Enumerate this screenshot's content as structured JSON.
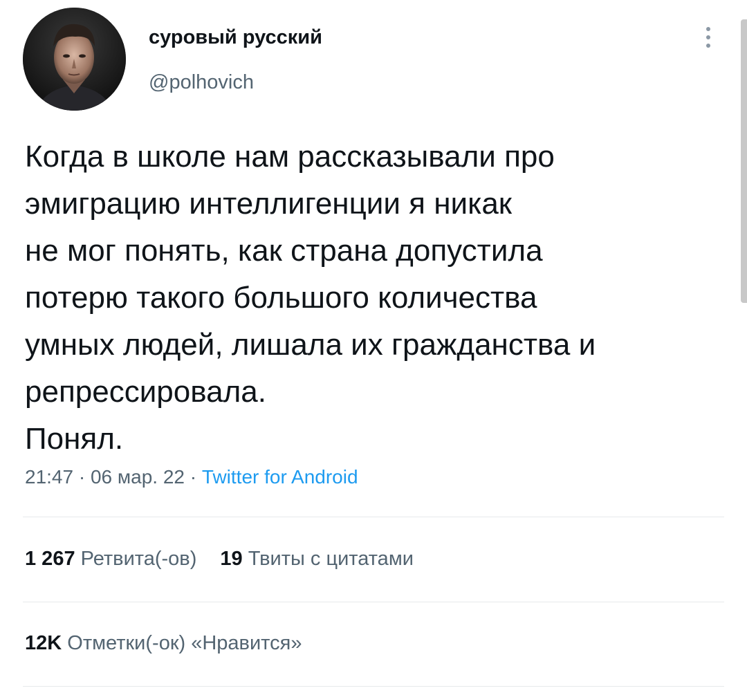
{
  "author": {
    "display_name": "суровый русский",
    "handle": "@polhovich",
    "avatar_icon": "user-photo-avatar"
  },
  "menu": {
    "icon": "more-vertical-icon"
  },
  "tweet": {
    "lines": [
      "Когда в школе нам рассказывали про",
      "эмиграцию интеллигенции я никак",
      "не мог понять, как страна допустила",
      "потерю такого большого количества",
      "умных людей, лишала их гражданства и",
      "репрессировала.",
      "Понял."
    ]
  },
  "meta": {
    "time": "21:47",
    "separator": " · ",
    "date": "06 мар. 22",
    "source": "Twitter for Android"
  },
  "stats": {
    "retweets_count": "1 267",
    "retweets_label": "Ретвита(-ов)",
    "quotes_count": "19",
    "quotes_label": "Твиты с цитатами",
    "likes_count": "12K",
    "likes_label": "Отметки(-ок) «Нравится»"
  },
  "colors": {
    "text": "#0f1419",
    "secondary": "#536471",
    "link": "#1d9bf0",
    "divider": "#e6e9eb"
  }
}
